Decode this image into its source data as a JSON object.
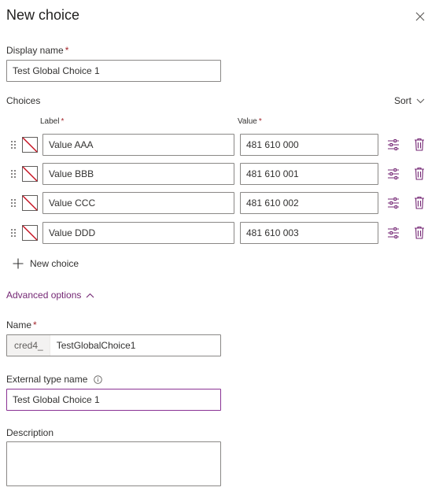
{
  "panel": {
    "title": "New choice"
  },
  "display_name": {
    "label": "Display name",
    "required_mark": "*",
    "value": "Test Global Choice 1"
  },
  "choices": {
    "section_label": "Choices",
    "sort_label": "Sort",
    "label_header": "Label",
    "value_header": "Value",
    "required_mark": "*",
    "items": [
      {
        "label": "Value AAA",
        "value": "481 610 000"
      },
      {
        "label": "Value BBB",
        "value": "481 610 001"
      },
      {
        "label": "Value CCC",
        "value": "481 610 002"
      },
      {
        "label": "Value DDD",
        "value": "481 610 003"
      }
    ],
    "new_choice_label": "New choice"
  },
  "advanced": {
    "label": "Advanced options"
  },
  "name": {
    "label": "Name",
    "required_mark": "*",
    "prefix": "cred4_",
    "value": "TestGlobalChoice1"
  },
  "external_type_name": {
    "label": "External type name",
    "value": "Test Global Choice 1"
  },
  "description": {
    "label": "Description",
    "value": ""
  },
  "colors": {
    "accent": "#8a3294",
    "link": "#742774",
    "required": "#a4262c",
    "swatch_slash": "#c50f1f",
    "icon": "#742774"
  }
}
